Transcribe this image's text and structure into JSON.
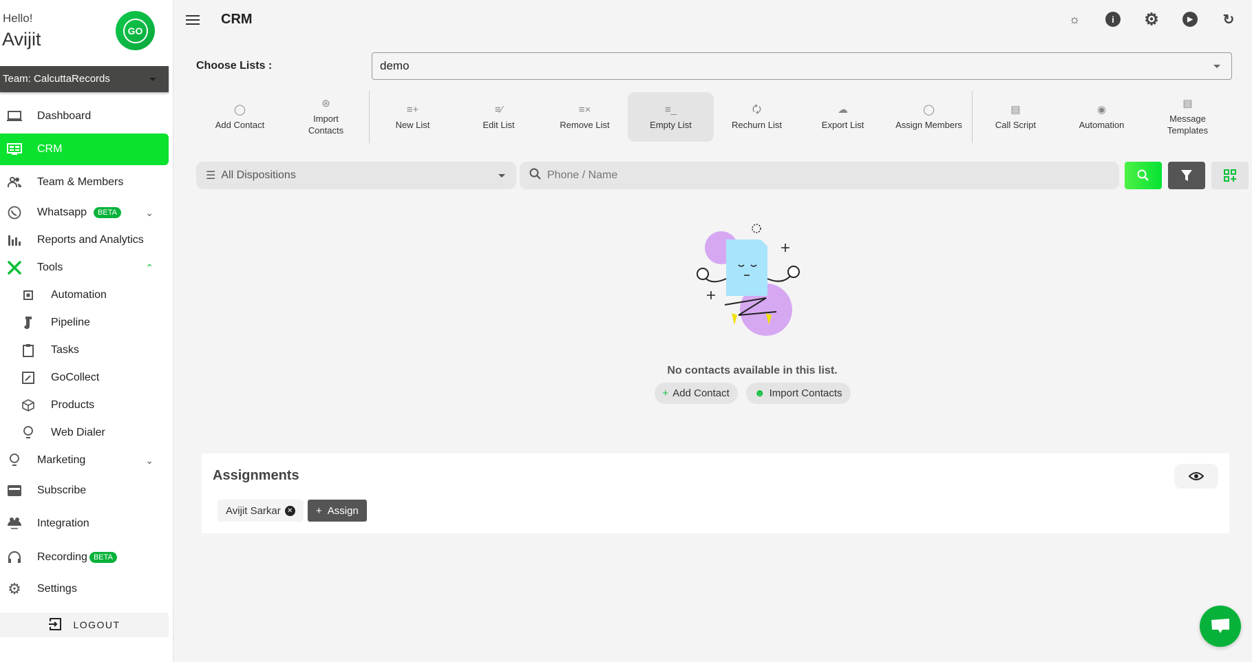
{
  "sidebar": {
    "greeting": "Hello!",
    "username": "Avijit",
    "logo_text": "GO",
    "team_label": "Team: CalcuttaRecords",
    "items": [
      {
        "label": "Dashboard",
        "icon": "laptop-icon"
      },
      {
        "label": "CRM",
        "icon": "crm-icon",
        "active": true
      },
      {
        "label": "Team & Members",
        "icon": "people-icon"
      },
      {
        "label": "Whatsapp",
        "icon": "whatsapp-icon",
        "badge": "BETA"
      },
      {
        "label": "Reports and Analytics",
        "icon": "bar-chart-icon"
      },
      {
        "label": "Tools",
        "icon": "tools-icon"
      },
      {
        "label": "Automation",
        "icon": "chip-icon"
      },
      {
        "label": "Pipeline",
        "icon": "pipeline-icon"
      },
      {
        "label": "Tasks",
        "icon": "clipboard-icon"
      },
      {
        "label": "GoCollect",
        "icon": "edit-box-icon"
      },
      {
        "label": "Products",
        "icon": "cube-icon"
      },
      {
        "label": "Web Dialer",
        "icon": "bulb-icon"
      },
      {
        "label": "Marketing",
        "icon": "bulb-icon"
      },
      {
        "label": "Subscribe",
        "icon": "card-icon"
      },
      {
        "label": "Integration",
        "icon": "integration-icon"
      },
      {
        "label": "Recording",
        "icon": "headphones-icon",
        "badge": "BETA"
      },
      {
        "label": "Settings",
        "icon": "gear-icon"
      }
    ],
    "logout_label": "LOGOUT"
  },
  "header": {
    "title": "CRM"
  },
  "lists": {
    "label": "Choose Lists :",
    "selected": "demo"
  },
  "toolbar": {
    "items": [
      {
        "label": "Add Contact"
      },
      {
        "label": "Import Contacts"
      },
      {
        "label": "New List"
      },
      {
        "label": "Edit List"
      },
      {
        "label": "Remove List"
      },
      {
        "label": "Empty List"
      },
      {
        "label": "Rechurn List"
      },
      {
        "label": "Export List"
      },
      {
        "label": "Assign Members"
      },
      {
        "label": "Call Script"
      },
      {
        "label": "Automation"
      },
      {
        "label": "Message Templates"
      }
    ]
  },
  "filters": {
    "disposition": "All Dispositions",
    "search_placeholder": "Phone / Name"
  },
  "empty_state": {
    "message": "No contacts available in this list.",
    "add_contact": "Add Contact",
    "import_contacts": "Import Contacts"
  },
  "assignments": {
    "title": "Assignments",
    "members": [
      "Avijit Sarkar"
    ],
    "assign_label": "Assign"
  },
  "colors": {
    "accent_green": "#0be12f",
    "brand_green": "#08b23a",
    "dark_button": "#555555"
  }
}
